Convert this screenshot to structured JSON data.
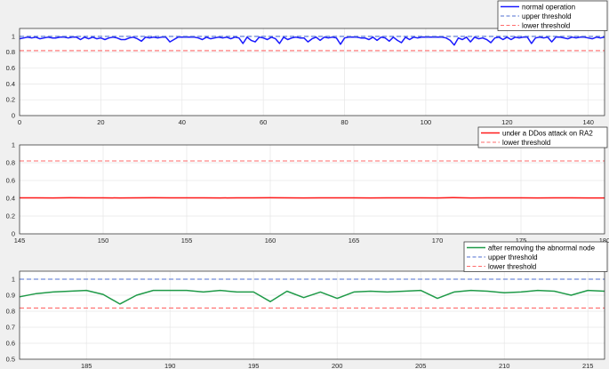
{
  "chart_data": [
    {
      "type": "line",
      "xlim": [
        0,
        144
      ],
      "ylim": [
        0,
        1.1
      ],
      "xticks": [
        "0",
        "20",
        "40",
        "60",
        "80",
        "100",
        "120",
        "140"
      ],
      "xtick_values": [
        0,
        20,
        40,
        60,
        80,
        100,
        120,
        140
      ],
      "yticks": [
        "0",
        "0.2",
        "0.4",
        "0.6",
        "0.8",
        "1"
      ],
      "ytick_values": [
        0,
        0.2,
        0.4,
        0.6,
        0.8,
        1
      ],
      "grid": true,
      "legend_position": "top-right-outside",
      "series": [
        {
          "name": "normal operation",
          "color": "#1a1aff",
          "style": "solid",
          "x_start": 0,
          "values": [
            0.97,
            0.98,
            0.99,
            0.98,
            0.99,
            0.97,
            0.98,
            0.99,
            0.98,
            0.98,
            0.99,
            0.99,
            0.98,
            0.99,
            0.99,
            0.96,
            0.99,
            0.97,
            0.99,
            0.97,
            0.98,
            0.96,
            0.98,
            0.99,
            0.98,
            0.96,
            0.96,
            0.98,
            0.99,
            0.97,
            0.94,
            0.99,
            0.98,
            0.99,
            0.98,
            0.99,
            0.99,
            0.93,
            0.96,
            0.99,
            0.99,
            0.99,
            0.99,
            0.99,
            0.98,
            0.96,
            0.99,
            0.97,
            0.98,
            0.99,
            0.98,
            0.99,
            0.97,
            0.99,
            0.98,
            0.91,
            0.99,
            0.95,
            0.93,
            0.99,
            0.98,
            0.96,
            0.99,
            0.97,
            0.91,
            0.99,
            0.96,
            0.98,
            0.99,
            0.98,
            0.98,
            0.93,
            0.97,
            0.99,
            0.95,
            0.99,
            0.98,
            0.99,
            0.98,
            0.9,
            0.98,
            0.99,
            0.99,
            0.99,
            0.98,
            0.98,
            0.96,
            0.99,
            0.95,
            0.99,
            0.98,
            0.94,
            0.99,
            0.95,
            0.92,
            0.99,
            0.96,
            0.99,
            0.98,
            0.99,
            0.99,
            0.99,
            0.99,
            0.99,
            0.99,
            0.98,
            0.95,
            0.89,
            0.98,
            0.96,
            0.99,
            0.93,
            0.99,
            0.97,
            0.98,
            0.96,
            0.92,
            0.98,
            0.99,
            0.96,
            0.99,
            0.96,
            0.99,
            0.98,
            0.99,
            0.99,
            0.91,
            0.98,
            0.99,
            0.98,
            0.99,
            0.93,
            0.99,
            0.99,
            0.98,
            0.97,
            0.99,
            0.98,
            0.99,
            0.99,
            0.98,
            0.97,
            0.99,
            0.98,
            0.99
          ]
        },
        {
          "name": "upper threshold",
          "color": "#4f6fd0",
          "style": "dashed",
          "constant": 1.0
        },
        {
          "name": "lower threshold",
          "color": "#ff6b6b",
          "style": "dashed",
          "constant": 0.82
        }
      ]
    },
    {
      "type": "line",
      "xlim": [
        145,
        180
      ],
      "ylim": [
        0,
        1
      ],
      "xticks": [
        "145",
        "150",
        "155",
        "160",
        "165",
        "170",
        "175",
        "180"
      ],
      "xtick_values": [
        145,
        150,
        155,
        160,
        165,
        170,
        175,
        180
      ],
      "yticks": [
        "0",
        "0.2",
        "0.4",
        "0.6",
        "0.8",
        "1"
      ],
      "ytick_values": [
        0,
        0.2,
        0.4,
        0.6,
        0.8,
        1
      ],
      "grid": true,
      "legend_position": "top-right-outside",
      "series": [
        {
          "name": "under a DDos attack on RA2",
          "color": "#ff1a1a",
          "style": "solid",
          "x_start": 145,
          "values": [
            0.405,
            0.405,
            0.404,
            0.406,
            0.405,
            0.405,
            0.404,
            0.405,
            0.406,
            0.405,
            0.405,
            0.405,
            0.404,
            0.405,
            0.405,
            0.406,
            0.405,
            0.404,
            0.405,
            0.405,
            0.405,
            0.404,
            0.405,
            0.405,
            0.405,
            0.404,
            0.408,
            0.404,
            0.405,
            0.405,
            0.405,
            0.404,
            0.405,
            0.405,
            0.404,
            0.404
          ]
        },
        {
          "name": "lower threshold",
          "color": "#ff6b6b",
          "style": "dashed",
          "constant": 0.82
        }
      ]
    },
    {
      "type": "line",
      "xlim": [
        181,
        216
      ],
      "ylim": [
        0.5,
        1.05
      ],
      "xticks": [
        "185",
        "190",
        "195",
        "200",
        "205",
        "210",
        "215"
      ],
      "xtick_values": [
        185,
        190,
        195,
        200,
        205,
        210,
        215
      ],
      "yticks": [
        "0.5",
        "0.6",
        "0.7",
        "0.8",
        "0.9",
        "1"
      ],
      "ytick_values": [
        0.5,
        0.6,
        0.7,
        0.8,
        0.9,
        1
      ],
      "grid": true,
      "legend_position": "top-right-outside",
      "series": [
        {
          "name": "after removing the abnormal node",
          "color": "#1f9a48",
          "style": "solid",
          "x_start": 181,
          "values": [
            0.89,
            0.91,
            0.92,
            0.925,
            0.93,
            0.905,
            0.845,
            0.9,
            0.93,
            0.93,
            0.93,
            0.92,
            0.93,
            0.92,
            0.92,
            0.86,
            0.925,
            0.885,
            0.92,
            0.88,
            0.92,
            0.925,
            0.92,
            0.925,
            0.93,
            0.88,
            0.92,
            0.93,
            0.925,
            0.915,
            0.92,
            0.93,
            0.925,
            0.9,
            0.93,
            0.925
          ]
        },
        {
          "name": "upper threshold",
          "color": "#4f6fd0",
          "style": "dashed",
          "constant": 1.0
        },
        {
          "name": "lower threshold",
          "color": "#ff6b6b",
          "style": "dashed",
          "constant": 0.82
        }
      ]
    }
  ]
}
